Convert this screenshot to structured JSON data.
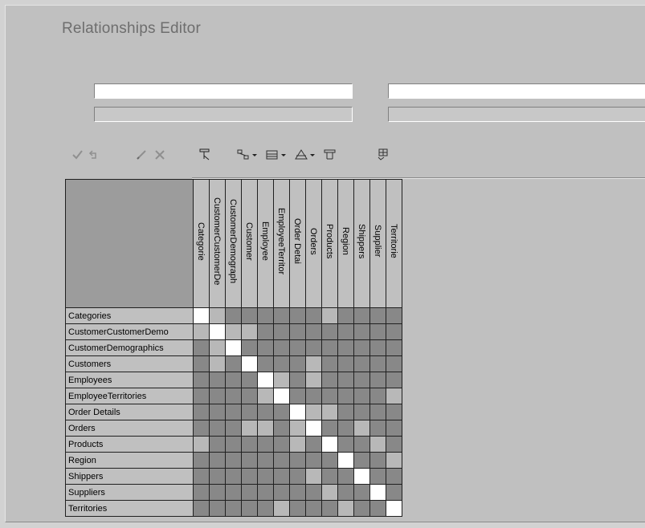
{
  "window": {
    "title": "Relationships Editor"
  },
  "fields": [
    {
      "value": "",
      "style": "white"
    },
    {
      "value": "",
      "style": "gray"
    },
    {
      "value": "",
      "style": "white"
    },
    {
      "value": "",
      "style": "gray"
    }
  ],
  "toolbar": {
    "buttons": [
      {
        "name": "apply-icon",
        "enabled": false
      },
      {
        "name": "undo-icon",
        "enabled": false
      },
      {
        "name": "edit-icon",
        "enabled": false
      },
      {
        "name": "delete-icon",
        "enabled": false
      },
      {
        "name": "clear-filter-icon",
        "enabled": true
      },
      {
        "name": "relation-type-icon",
        "enabled": true,
        "dropdown": true
      },
      {
        "name": "table-type-icon",
        "enabled": true,
        "dropdown": true
      },
      {
        "name": "sort-icon",
        "enabled": true,
        "dropdown": true
      },
      {
        "name": "filter-icon",
        "enabled": true
      },
      {
        "name": "auto-layout-icon",
        "enabled": true
      }
    ]
  },
  "matrix": {
    "columns": [
      "Categorie",
      "CustomerCustomerDe",
      "CustomerDemograph",
      "Customer",
      "Employee",
      "EmployeeTerritor",
      "Order Detai",
      "Orders",
      "Products",
      "Region",
      "Shippers",
      "Supplier",
      "Territorie"
    ],
    "rows": [
      "Categories",
      "CustomerCustomerDemo",
      "CustomerDemographics",
      "Customers",
      "Employees",
      "EmployeeTerritories",
      "Order Details",
      "Orders",
      "Products",
      "Region",
      "Shippers",
      "Suppliers",
      "Territories"
    ],
    "related": [
      [
        1,
        0
      ],
      [
        0,
        1
      ],
      [
        1,
        2
      ],
      [
        2,
        1
      ],
      [
        1,
        3
      ],
      [
        3,
        1
      ],
      [
        4,
        4
      ],
      [
        4,
        5
      ],
      [
        5,
        4
      ],
      [
        6,
        7
      ],
      [
        7,
        6
      ],
      [
        6,
        8
      ],
      [
        8,
        6
      ],
      [
        7,
        3
      ],
      [
        3,
        7
      ],
      [
        7,
        4
      ],
      [
        4,
        7
      ],
      [
        7,
        10
      ],
      [
        10,
        7
      ],
      [
        8,
        0
      ],
      [
        0,
        8
      ],
      [
        8,
        11
      ],
      [
        11,
        8
      ],
      [
        9,
        12
      ],
      [
        12,
        9
      ],
      [
        5,
        12
      ],
      [
        12,
        5
      ]
    ],
    "colors": {
      "self": "#ffffff",
      "related": "#b8b8b8",
      "none": "#888888"
    }
  }
}
